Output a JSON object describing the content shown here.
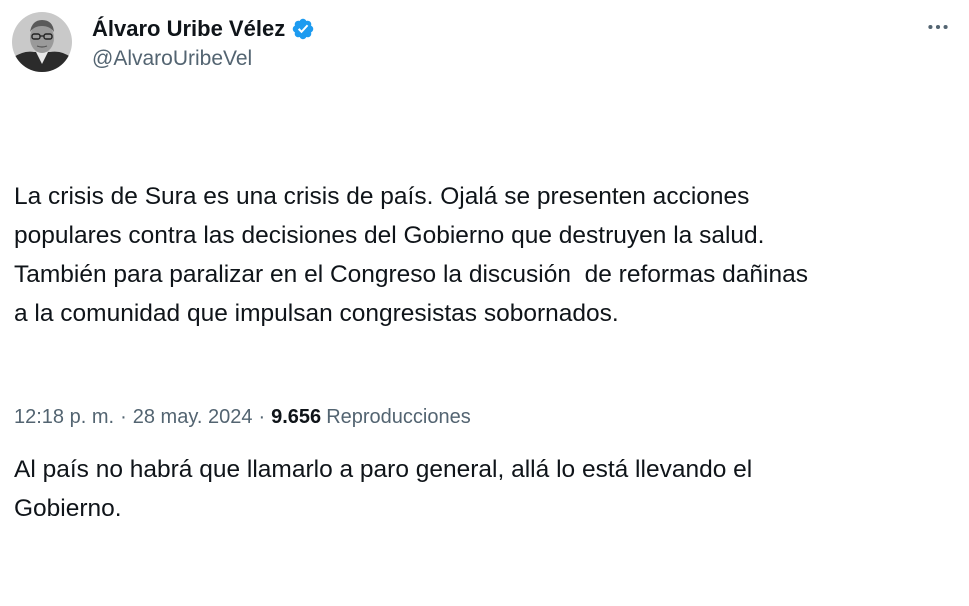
{
  "author": {
    "display_name": "Álvaro Uribe Vélez",
    "handle": "@AlvaroUribeVel",
    "verified": true,
    "verified_badge_color": "#1d9bf0"
  },
  "menu": {
    "icon": "more-horizontal-icon"
  },
  "tweet": {
    "paragraphs": [
      "La crisis de Sura es una crisis de país. Ojalá se presenten acciones\npopulares contra las decisiones del Gobierno que destruyen la salud.\nTambién para paralizar en el Congreso la discusión  de reformas dañinas\na la comunidad que impulsan congresistas sobornados.",
      "Al país no habrá que llamarlo a paro general, allá lo está llevando el\nGobierno."
    ]
  },
  "meta": {
    "time": "12:18 p. m.",
    "separator": "·",
    "date": "28 may. 2024",
    "views_count": "9.656",
    "views_label": "Reproducciones"
  },
  "colors": {
    "text_primary": "#0f1419",
    "text_secondary": "#536471",
    "accent": "#1d9bf0"
  }
}
